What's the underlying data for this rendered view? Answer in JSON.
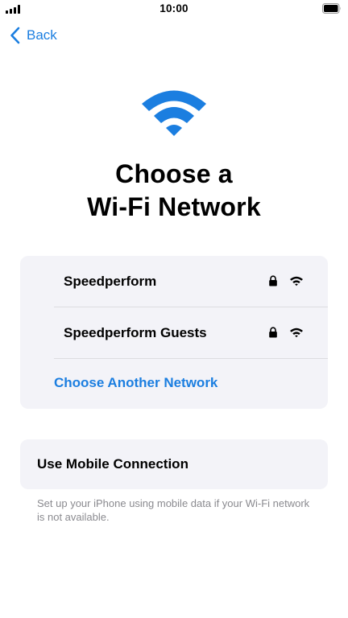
{
  "status_bar": {
    "time": "10:00"
  },
  "nav": {
    "back_label": "Back"
  },
  "colors": {
    "accent": "#1b7ee0",
    "card_background": "#f3f3f8",
    "secondary_text": "#8a8a8f"
  },
  "hero": {
    "icon": "wifi-icon",
    "title_line1": "Choose a",
    "title_line2": "Wi-Fi Network"
  },
  "networks": [
    {
      "name": "Speedperform",
      "secured": true,
      "icons": [
        "lock-icon",
        "wifi-signal-icon"
      ]
    },
    {
      "name": "Speedperform Guests",
      "secured": true,
      "icons": [
        "lock-icon",
        "wifi-signal-icon"
      ]
    }
  ],
  "choose_another": {
    "label": "Choose Another Network"
  },
  "mobile": {
    "label": "Use Mobile Connection",
    "footnote": "Set up your iPhone using mobile data if your Wi-Fi network is not available."
  }
}
